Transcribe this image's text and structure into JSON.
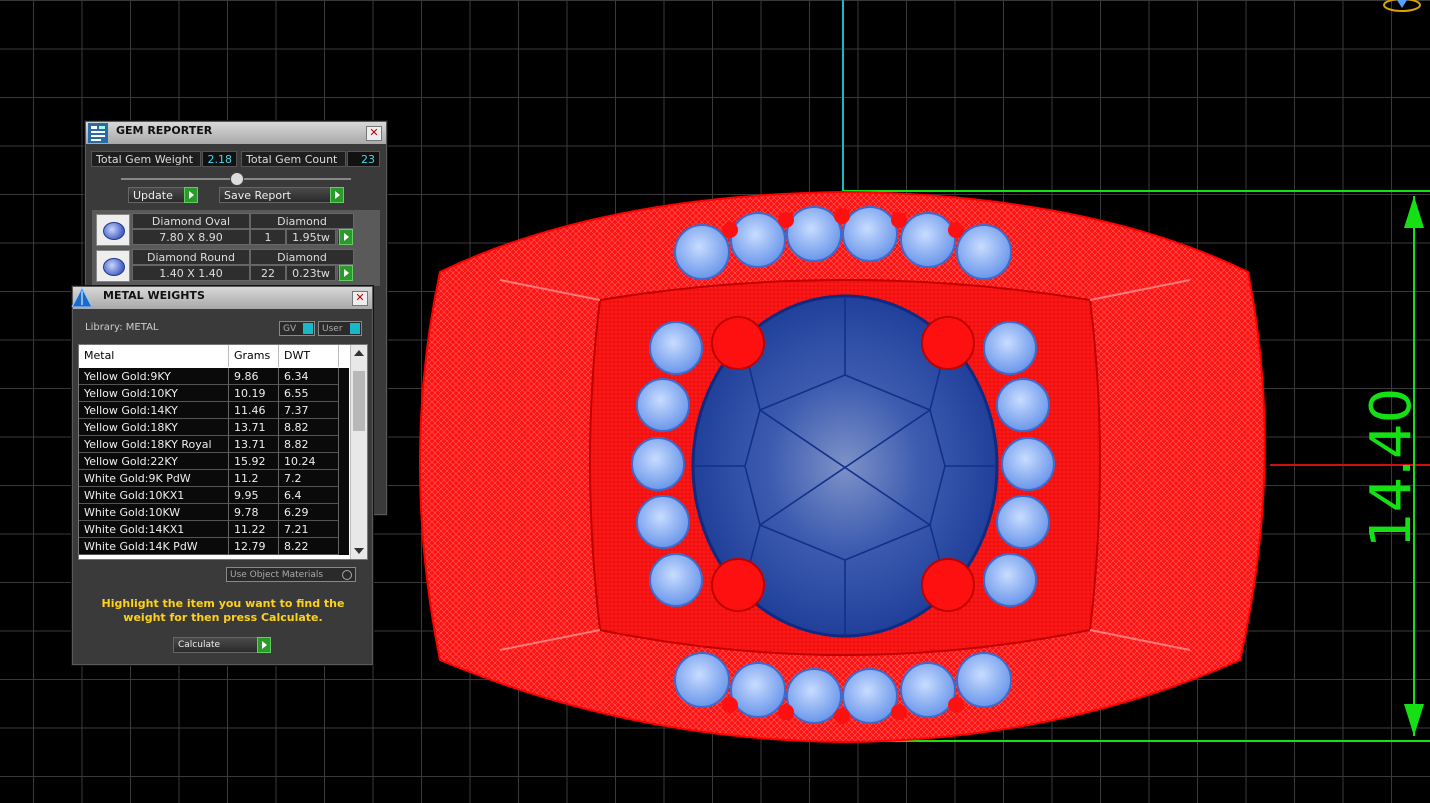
{
  "gem_reporter": {
    "title": "GEM REPORTER",
    "total_weight_label": "Total Gem Weight",
    "total_weight_value": "2.18",
    "total_count_label": "Total Gem Count",
    "total_count_value": "23",
    "update_label": "Update",
    "save_label": "Save Report",
    "gems": [
      {
        "name": "Diamond Oval",
        "material": "Diamond",
        "size": "7.80 X 8.90",
        "count": "1",
        "weight": "1.95tw"
      },
      {
        "name": "Diamond Round",
        "material": "Diamond",
        "size": "1.40 X 1.40",
        "count": "22",
        "weight": "0.23tw"
      }
    ]
  },
  "metal_weights": {
    "title": "METAL WEIGHTS",
    "library_label": "Library: METAL",
    "toggle_gv": "GV",
    "toggle_user": "User",
    "columns": [
      "Metal",
      "Grams",
      "DWT"
    ],
    "rows": [
      [
        "Yellow Gold:9KY",
        "9.86",
        "6.34"
      ],
      [
        "Yellow Gold:10KY",
        "10.19",
        "6.55"
      ],
      [
        "Yellow Gold:14KY",
        "11.46",
        "7.37"
      ],
      [
        "Yellow Gold:18KY",
        "13.71",
        "8.82"
      ],
      [
        "Yellow Gold:18KY Royal",
        "13.71",
        "8.82"
      ],
      [
        "Yellow Gold:22KY",
        "15.92",
        "10.24"
      ],
      [
        "White Gold:9K PdW",
        "11.2",
        "7.2"
      ],
      [
        "White Gold:10KX1",
        "9.95",
        "6.4"
      ],
      [
        "White Gold:10KW",
        "9.78",
        "6.29"
      ],
      [
        "White Gold:14KX1",
        "11.22",
        "7.21"
      ],
      [
        "White Gold:14K PdW",
        "12.79",
        "8.22"
      ]
    ],
    "use_object_materials": "Use Object Materials",
    "hint": "Highlight the item you want to find the weight for then press Calculate.",
    "calculate_label": "Calculate"
  },
  "viewport": {
    "dimension_label": "14.40",
    "colors": {
      "metal": "#ff1a1a",
      "center_stone": "#1f3fa0",
      "accent_stones": "#7fa8f0",
      "dimension": "#14e014",
      "grid": "#3a3a3a"
    }
  }
}
